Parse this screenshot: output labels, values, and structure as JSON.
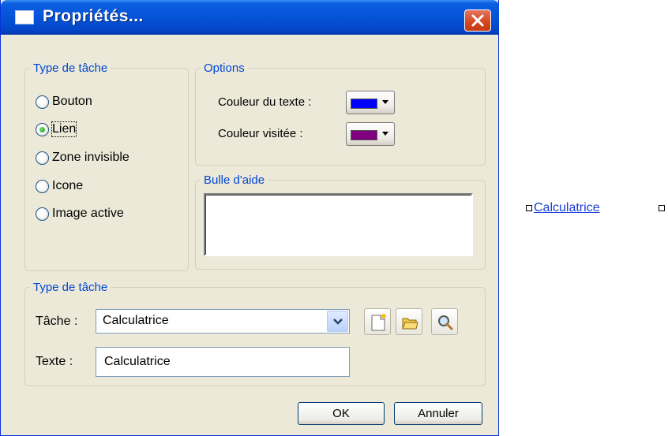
{
  "dialog": {
    "title": "Propriétés..."
  },
  "task_type_group": {
    "legend": "Type de tâche",
    "options": [
      {
        "label": "Bouton",
        "checked": false
      },
      {
        "label": "Lien",
        "checked": true
      },
      {
        "label": "Zone invisible",
        "checked": false
      },
      {
        "label": "Icone",
        "checked": false
      },
      {
        "label": "Image active",
        "checked": false
      }
    ]
  },
  "options_group": {
    "legend": "Options",
    "text_color_label": "Couleur du texte :",
    "text_color": "#0000ff",
    "visited_color_label": "Couleur visitée :",
    "visited_color": "#800080"
  },
  "tooltip_group": {
    "legend": "Bulle d'aide",
    "value": ""
  },
  "task_group": {
    "legend": "Type de tâche",
    "task_label": "Tâche :",
    "task_value": "Calculatrice",
    "text_label": "Texte :",
    "text_value": "Calculatrice"
  },
  "buttons": {
    "ok": "OK",
    "cancel": "Annuler"
  },
  "preview": {
    "link_text": "Calculatrice",
    "link_color": "#1a3cd6"
  },
  "icons": {
    "title": "window-icon",
    "close": "close-icon",
    "new": "new-document-icon",
    "open": "folder-open-icon",
    "browse": "magnifier-icon"
  }
}
